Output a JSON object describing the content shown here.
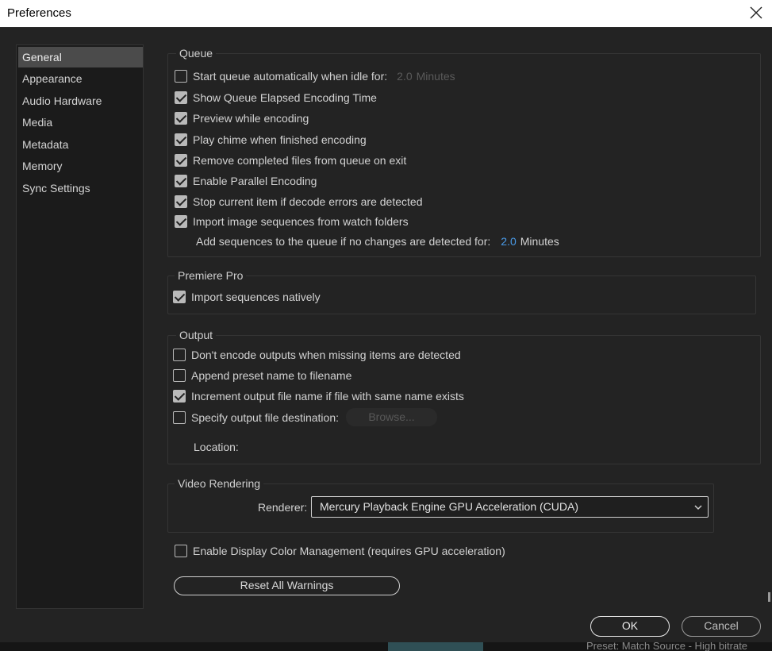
{
  "window": {
    "title": "Preferences"
  },
  "sidebar": {
    "items": [
      {
        "label": "General",
        "selected": true
      },
      {
        "label": "Appearance"
      },
      {
        "label": "Audio Hardware"
      },
      {
        "label": "Media"
      },
      {
        "label": "Metadata"
      },
      {
        "label": "Memory"
      },
      {
        "label": "Sync Settings"
      }
    ]
  },
  "queue": {
    "title": "Queue",
    "start_auto": {
      "label": "Start queue automatically when idle for:",
      "checked": false,
      "value": "2.0",
      "unit": "Minutes"
    },
    "options": [
      {
        "label": "Show Queue Elapsed Encoding Time",
        "checked": true
      },
      {
        "label": "Preview while encoding",
        "checked": true
      },
      {
        "label": "Play chime when finished encoding",
        "checked": true
      },
      {
        "label": "Remove completed files from queue on exit",
        "checked": true
      },
      {
        "label": "Enable Parallel Encoding",
        "checked": true
      },
      {
        "label": "Stop current item if decode errors are detected",
        "checked": true
      },
      {
        "label": "Import image sequences from watch folders",
        "checked": true
      }
    ],
    "add_sequences": {
      "label": "Add sequences to the queue if no changes are detected for:",
      "value": "2.0",
      "unit": "Minutes"
    }
  },
  "premiere": {
    "title": "Premiere Pro",
    "import_native": {
      "label": "Import sequences natively",
      "checked": true
    }
  },
  "output": {
    "title": "Output",
    "options": [
      {
        "label": "Don't encode outputs when missing items are detected",
        "checked": false
      },
      {
        "label": "Append preset name to filename",
        "checked": false
      },
      {
        "label": "Increment output file name if file with same name exists",
        "checked": true
      }
    ],
    "specify": {
      "label": "Specify output file destination:",
      "checked": false
    },
    "browse_label": "Browse...",
    "location_label": "Location:"
  },
  "video_rendering": {
    "title": "Video Rendering",
    "renderer_label": "Renderer:",
    "renderer_value": "Mercury Playback Engine GPU Acceleration (CUDA)"
  },
  "color_management": {
    "label": "Enable Display Color Management (requires GPU acceleration)",
    "checked": false
  },
  "buttons": {
    "reset_warnings": "Reset All Warnings",
    "ok": "OK",
    "cancel": "Cancel"
  },
  "background_strip_text": "Preset:    Match Source - High bitrate"
}
